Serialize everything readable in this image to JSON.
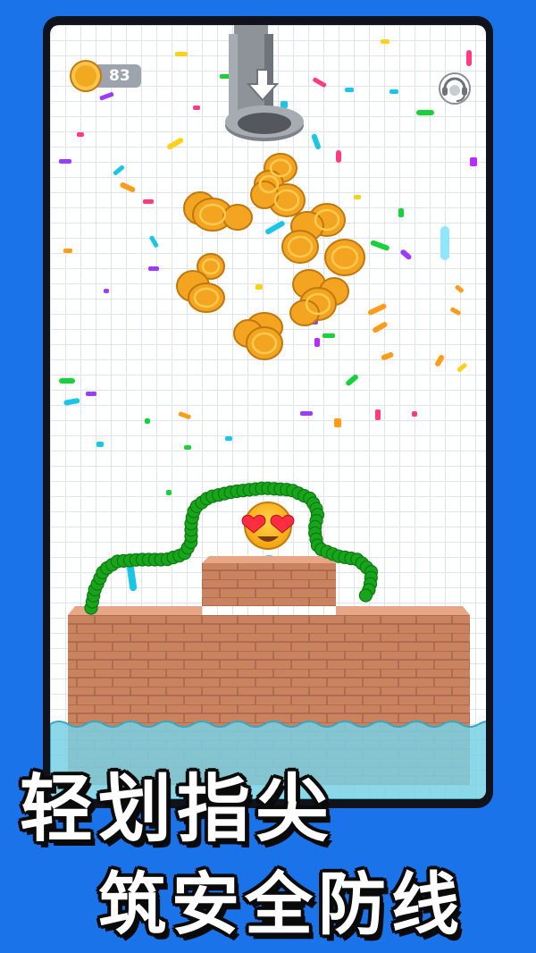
{
  "hud": {
    "coin_count": "83",
    "coin_icon": "coin-icon",
    "support_icon": "headset-support-icon"
  },
  "scene": {
    "pipe_icon": "down-arrow-icon",
    "emoji": "heart-eyes-emoji",
    "colors": {
      "background": "#1a73e8",
      "brick": "#c9835f",
      "brick_top": "#e7a787",
      "rope": "#19a51b",
      "water": "#79d1e4",
      "coin": "#f2a922"
    }
  },
  "promo": {
    "line1": "轻划指尖",
    "line2": "筑安全防线"
  }
}
